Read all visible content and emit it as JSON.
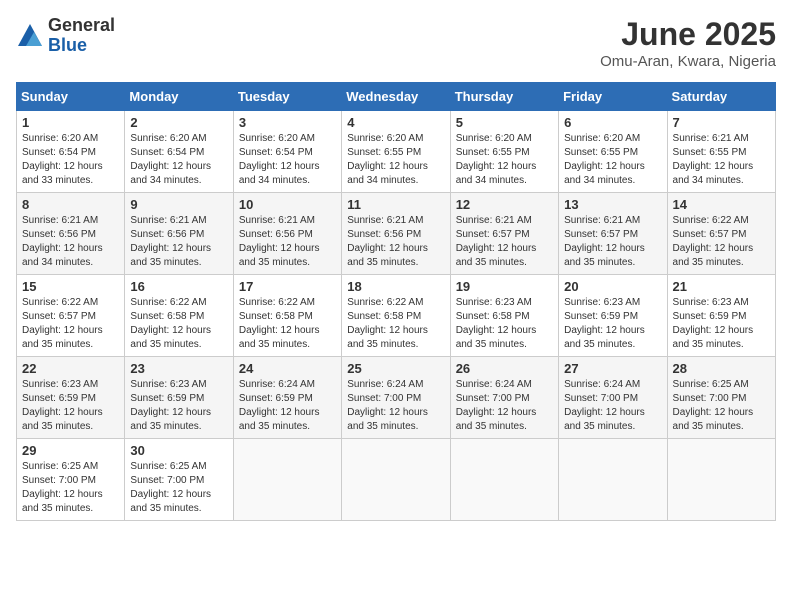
{
  "logo": {
    "general": "General",
    "blue": "Blue"
  },
  "title": "June 2025",
  "subtitle": "Omu-Aran, Kwara, Nigeria",
  "days_of_week": [
    "Sunday",
    "Monday",
    "Tuesday",
    "Wednesday",
    "Thursday",
    "Friday",
    "Saturday"
  ],
  "weeks": [
    [
      {
        "day": "1",
        "sunrise": "6:20 AM",
        "sunset": "6:54 PM",
        "daylight": "12 hours and 33 minutes."
      },
      {
        "day": "2",
        "sunrise": "6:20 AM",
        "sunset": "6:54 PM",
        "daylight": "12 hours and 34 minutes."
      },
      {
        "day": "3",
        "sunrise": "6:20 AM",
        "sunset": "6:54 PM",
        "daylight": "12 hours and 34 minutes."
      },
      {
        "day": "4",
        "sunrise": "6:20 AM",
        "sunset": "6:55 PM",
        "daylight": "12 hours and 34 minutes."
      },
      {
        "day": "5",
        "sunrise": "6:20 AM",
        "sunset": "6:55 PM",
        "daylight": "12 hours and 34 minutes."
      },
      {
        "day": "6",
        "sunrise": "6:20 AM",
        "sunset": "6:55 PM",
        "daylight": "12 hours and 34 minutes."
      },
      {
        "day": "7",
        "sunrise": "6:21 AM",
        "sunset": "6:55 PM",
        "daylight": "12 hours and 34 minutes."
      }
    ],
    [
      {
        "day": "8",
        "sunrise": "6:21 AM",
        "sunset": "6:56 PM",
        "daylight": "12 hours and 34 minutes."
      },
      {
        "day": "9",
        "sunrise": "6:21 AM",
        "sunset": "6:56 PM",
        "daylight": "12 hours and 35 minutes."
      },
      {
        "day": "10",
        "sunrise": "6:21 AM",
        "sunset": "6:56 PM",
        "daylight": "12 hours and 35 minutes."
      },
      {
        "day": "11",
        "sunrise": "6:21 AM",
        "sunset": "6:56 PM",
        "daylight": "12 hours and 35 minutes."
      },
      {
        "day": "12",
        "sunrise": "6:21 AM",
        "sunset": "6:57 PM",
        "daylight": "12 hours and 35 minutes."
      },
      {
        "day": "13",
        "sunrise": "6:21 AM",
        "sunset": "6:57 PM",
        "daylight": "12 hours and 35 minutes."
      },
      {
        "day": "14",
        "sunrise": "6:22 AM",
        "sunset": "6:57 PM",
        "daylight": "12 hours and 35 minutes."
      }
    ],
    [
      {
        "day": "15",
        "sunrise": "6:22 AM",
        "sunset": "6:57 PM",
        "daylight": "12 hours and 35 minutes."
      },
      {
        "day": "16",
        "sunrise": "6:22 AM",
        "sunset": "6:58 PM",
        "daylight": "12 hours and 35 minutes."
      },
      {
        "day": "17",
        "sunrise": "6:22 AM",
        "sunset": "6:58 PM",
        "daylight": "12 hours and 35 minutes."
      },
      {
        "day": "18",
        "sunrise": "6:22 AM",
        "sunset": "6:58 PM",
        "daylight": "12 hours and 35 minutes."
      },
      {
        "day": "19",
        "sunrise": "6:23 AM",
        "sunset": "6:58 PM",
        "daylight": "12 hours and 35 minutes."
      },
      {
        "day": "20",
        "sunrise": "6:23 AM",
        "sunset": "6:59 PM",
        "daylight": "12 hours and 35 minutes."
      },
      {
        "day": "21",
        "sunrise": "6:23 AM",
        "sunset": "6:59 PM",
        "daylight": "12 hours and 35 minutes."
      }
    ],
    [
      {
        "day": "22",
        "sunrise": "6:23 AM",
        "sunset": "6:59 PM",
        "daylight": "12 hours and 35 minutes."
      },
      {
        "day": "23",
        "sunrise": "6:23 AM",
        "sunset": "6:59 PM",
        "daylight": "12 hours and 35 minutes."
      },
      {
        "day": "24",
        "sunrise": "6:24 AM",
        "sunset": "6:59 PM",
        "daylight": "12 hours and 35 minutes."
      },
      {
        "day": "25",
        "sunrise": "6:24 AM",
        "sunset": "7:00 PM",
        "daylight": "12 hours and 35 minutes."
      },
      {
        "day": "26",
        "sunrise": "6:24 AM",
        "sunset": "7:00 PM",
        "daylight": "12 hours and 35 minutes."
      },
      {
        "day": "27",
        "sunrise": "6:24 AM",
        "sunset": "7:00 PM",
        "daylight": "12 hours and 35 minutes."
      },
      {
        "day": "28",
        "sunrise": "6:25 AM",
        "sunset": "7:00 PM",
        "daylight": "12 hours and 35 minutes."
      }
    ],
    [
      {
        "day": "29",
        "sunrise": "6:25 AM",
        "sunset": "7:00 PM",
        "daylight": "12 hours and 35 minutes."
      },
      {
        "day": "30",
        "sunrise": "6:25 AM",
        "sunset": "7:00 PM",
        "daylight": "12 hours and 35 minutes."
      },
      null,
      null,
      null,
      null,
      null
    ]
  ]
}
